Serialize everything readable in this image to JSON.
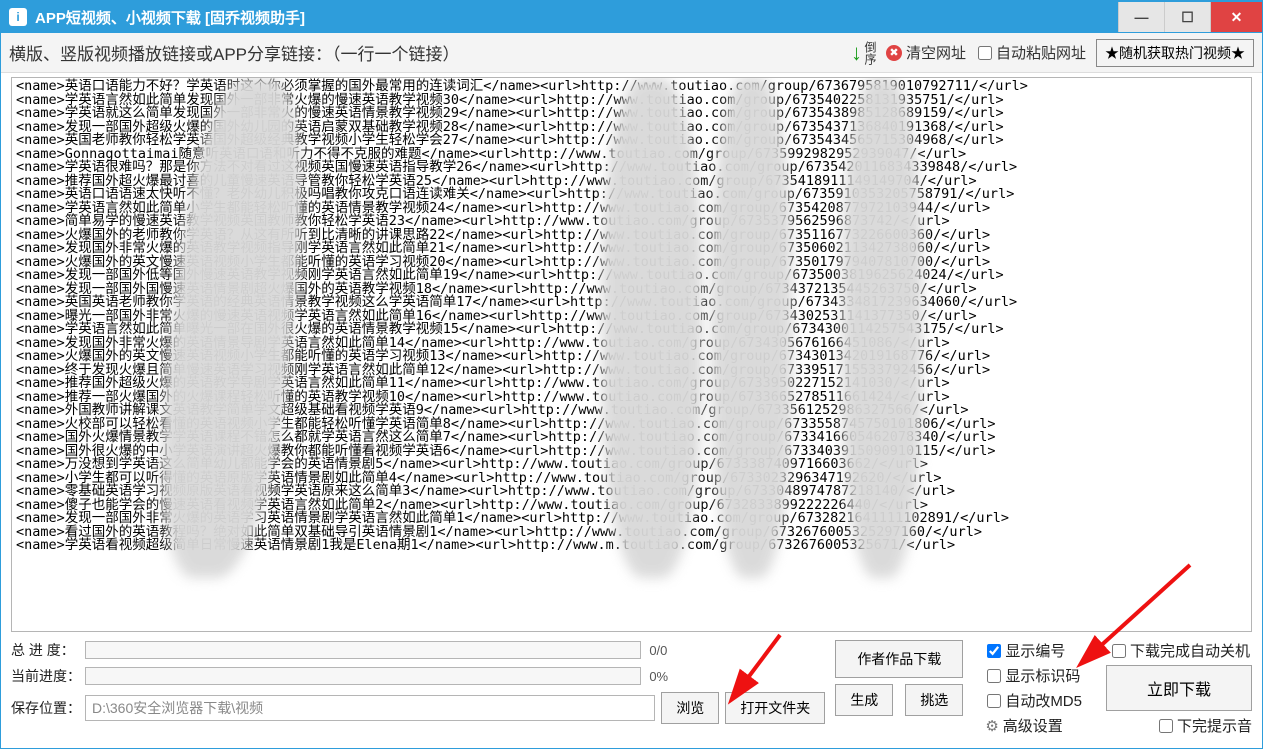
{
  "title": "APP短视频、小视频下载 [固乔视频助手]",
  "toolbar": {
    "hint": "横版、竖版视频播放链接或APP分享链接：（一行一个链接）",
    "reverse": "倒序",
    "clear": "清空网址",
    "autopaste": "自动粘贴网址",
    "random": "★随机获取热门视频★"
  },
  "textarea_lines": [
    "<name>英语口语能力不好？学英语时这个你必须掌握的国外最常用的连读词汇</name><url>http://www.toutiao.com/group/6736795819010792711/</url>",
    "<name>学英语言然如此简单发现国外一部非常火爆的慢速英语教学视频30</name><url>http://www.toutiao.com/group/6735402258131935751/</url>",
    "<name>学英语就这么简单发现国外一部非常火的慢速英语情景教学视频29</name><url>http://www.toutiao.com/group/6735438985128689159/</url>",
    "<name>发现一部国外超级火爆的国外幼儿园的英语启蒙双基础教学视频28</name><url>http://www.toutiao.com/group/6735437136840191368/</url>",
    "<name>英国老师教你轻松学英语国外超级经典教学视频小学生轻松学会27</name><url>http://www.toutiao.com/group/6735434565715304968/</url>",
    "<name>Gonnagottaimai随意听英语口语和听力不得不克服的难题</name><url>http://www.toutiao.com/group/6735992982952939047/</url>",
    "<name>学英语很难吗？那是你方法不对看过这视频英国慢速英语指导教学26</name><url>http://www.toutiao.com/group/6735420116834339848/</url>",
    "<name>推荐国外超火爆最讨喜的儿童慢速英语导管教你轻松学英语25</name><url>http://www.toutiao.com/group/6735418911149149704/</url>",
    "<name>英语口语语速太快听不懂？老外幼儿积极吗唱教你攻克口语连读难关</name><url>http://www.toutiao.com/group/6735910353205758791/</url>",
    "<name>学英语言然如此简单小学生都能轻松听懂的英语情景教学视频24</name><url>http://www.toutiao.com/group/6735420877972103944/</url>",
    "<name>简单易学的慢速英语教学视频英国教师教你轻松学英语23</name><url>http://www.toutiao.com/group/6735379562596873742/</url>",
    "<name>火爆国外的老师教你学英语？从这有所听到比清晰的讲课思路22</name><url>http://www.toutiao.com/group/6735116773226600360/</url>",
    "<name>发现国外非常火爆的英语教学视频指导刚学英语言然如此简单21</name><url>http://www.toutiao.com/group/6735060211342738060/</url>",
    "<name>火爆国外的英文慢速英语视频小学生都能听懂的英语学习视频20</name><url>http://www.toutiao.com/group/6735017979407810700/</url>",
    "<name>发现一部国外低等国外慢速英语教学视频刚学英语言然如此简单19</name><url>http://www.toutiao.com/group/6735003819625624024/</url>",
    "<name>发现一部国外国慢速英语情景剧超火爆国外的英语教学视频18</name><url>http://www.toutiao.com/group/6734372135445263750/</url>",
    "<name>英国英语老师教你学英语的经典英语情景教学视频这么学英语简单17</name><url>http://www.toutiao.com/group/6734334817239634060/</url>",
    "<name>曝光一部国外非常火爆的慢速英语视频学英语言然如此简单16</name><url>http://www.toutiao.com/group/6734302531141377350/</url>",
    "<name>学英语言然如此简单曝光一部在国外很火爆的英语情景教学视频15</name><url>http://www.toutiao.com/group/6734300114257543175/</url>",
    "<name>发现国外非常火爆的英语情景导剧学英语言然如此简单14</name><url>http://www.toutiao.com/group/6734305676166451086/</url>",
    "<name>火爆国外的英文慢速英语视频小学生都能听懂的英语学习视频13</name><url>http://www.toutiao.com/group/6734301342019168776/</url>",
    "<name>终于发现火爆且简单慢速英语学习视频刚学英语言然如此简单12</name><url>http://www.toutiao.com/group/6733951715533792456/</url>",
    "<name>推荐国外超级火爆的英语教学导剧学英语言然如此简单11</name><url>http://www.toutiao.com/group/6733950227152141030/</url>",
    "<name>推荐一部火爆国外的火爆课程轻松听懂的英语教学视频10</name><url>http://www.toutiao.com/group/6733665278511661424/</url>",
    "<name>外国教师讲解课文英语教学简单学文超级基础看视频学英语9</name><url>http://www.toutiao.com/group/6733561252986327566/</url>",
    "<name>火校部可以轻松看懂的英语视频小学生都能轻松听懂学英语简单8</name><url>http://www.toutiao.com/group/6733558745750101806/</url>",
    "<name>国外火爆情景教学学英语课程不错怎么都就学英语言然这么简单7</name><url>http://www.toutiao.com/group/6733416605462078340/</url>",
    "<name>国外很火爆的中小学英语演讲超火爆教你都能听懂看视频学英语6</name><url>http://www.toutiao.com/group/6733403915090910115/</url>",
    "<name>万没想到学英语这么简单幼儿都能学会的英语情景剧5</name><url>http://www.toutiao.com/group/6733387409716603662/</url>",
    "<name>小学生都可以听得懂的英语原版学英语情景剧如此简单4</name><url>http://www.toutiao.com/group/6733023296347192620/</url>",
    "<name>零基础英语学习视频原版英语看视频学英语原来这么简单3</name><url>http://www.toutiao.com/group/6733048974787218140/</url>",
    "<name>傻子也能学会的慢速英语看视频学英语言然如此简单2</name><url>http://www.toutiao.com/group/6732833899222226440/</url>",
    "<name>发现一部国外非常火爆的英语学习英语情景剧学英语言然如此简单1</name><url>http://www.toutiao.com/group/6732821641111102891/</url>",
    "<name>看过国外的英语教程吗？绝对如此简单双基础导引英语情景剧1</name><url>http://www.toutiao.com/group/6732676005325297160/</url>",
    "<name>学英语看视频超级简单日常慢速英语情景剧1我是Elena期1</name><url>http://www.m.toutiao.com/group/6732676005325671/</url>"
  ],
  "bottom": {
    "total_label": "总 进 度：",
    "total_value": "0/0",
    "current_label": "当前进度：",
    "current_value": "0%",
    "save_label": "保存位置：",
    "save_path": "D:\\360安全浏览器下载\\视频",
    "browse": "浏览",
    "open_folder": "打开文件夹",
    "author_works": "作者作品下载",
    "generate": "生成",
    "filter": "挑选",
    "show_number": "显示编号",
    "show_idcode": "显示标识码",
    "auto_md5": "自动改MD5",
    "advanced": "高级设置",
    "auto_shutdown": "下载完成自动关机",
    "download_now": "立即下载",
    "done_sound": "下完提示音"
  }
}
